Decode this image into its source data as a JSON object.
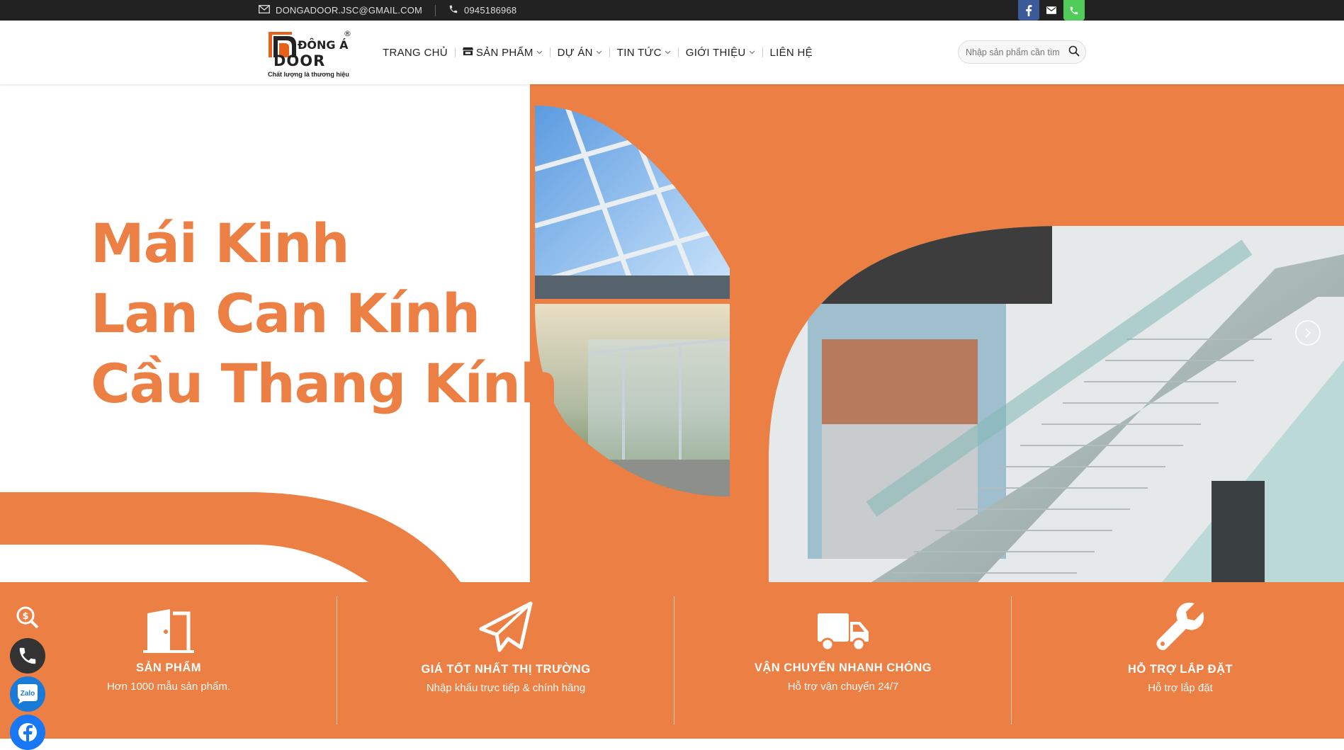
{
  "topbar": {
    "email": "DONGADOOR.JSC@GMAIL.COM",
    "phone": "0945186968",
    "social_icons": [
      "facebook-icon",
      "mail-icon",
      "phone-icon"
    ]
  },
  "header": {
    "logo_alt": "ĐÔNG Á DOOR",
    "logo_text_top": "ĐÔNG Á",
    "logo_text_main": "DOOR",
    "logo_slogan": "Chất lượng là thương hiệu",
    "nav": [
      {
        "label": "TRANG CHỦ"
      },
      {
        "label": "SẢN PHẨM"
      },
      {
        "label": "DỰ ÁN"
      },
      {
        "label": "TIN TỨC"
      },
      {
        "label": "GIỚI THIỆU"
      },
      {
        "label": "LIÊN HỆ"
      }
    ],
    "search_placeholder": "Nhập sản phẩm cần tìm"
  },
  "hero": {
    "lines": [
      "Mái Kinh",
      "Lan Can Kính",
      "Cầu Thang Kính"
    ]
  },
  "features": [
    {
      "title": "SẢN PHẨM",
      "subtitle": "Hơn 1000 mẫu sản phẩm."
    },
    {
      "title": "GIÁ TỐT NHẤT THỊ TRƯỜNG",
      "subtitle": "Nhập khẩu trực tiếp & chính hãng"
    },
    {
      "title": "VẬN CHUYỂN NHANH CHÓNG",
      "subtitle": "Hỗ trợ vận chuyển 24/7"
    },
    {
      "title": "HỖ TRỢ LẮP ĐẶT",
      "subtitle": "Hỗ trợ lắp đặt"
    }
  ],
  "floating": {
    "zalo": "Zalo"
  },
  "colors": {
    "brand_orange": "#ec7f43",
    "topbar": "#222222",
    "facebook": "#3a5a98",
    "phone_green": "#51cb5a",
    "zalo_blue": "#1a7ad8"
  }
}
